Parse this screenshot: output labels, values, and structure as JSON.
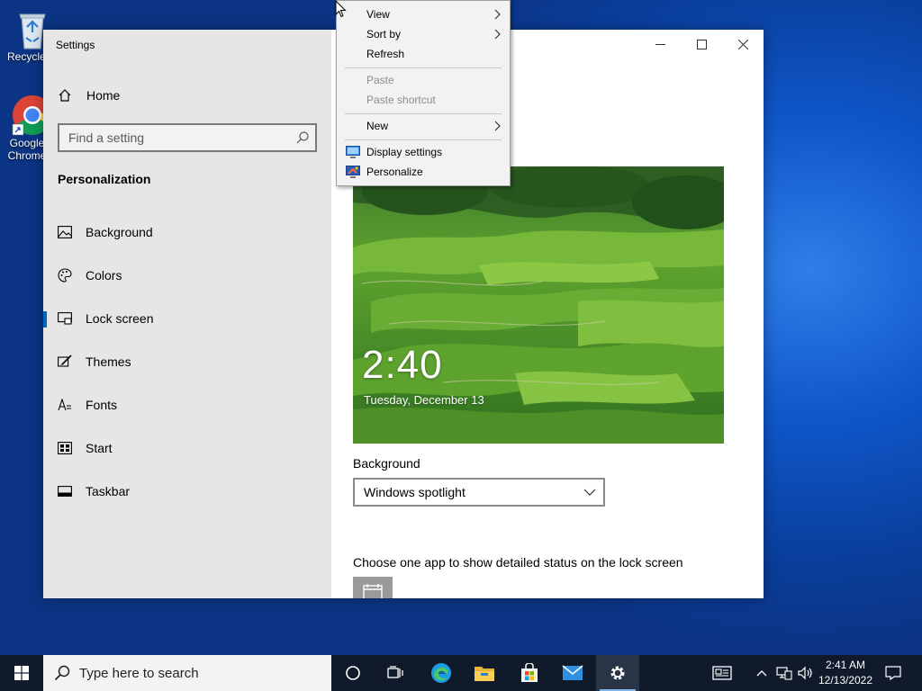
{
  "desktop": {
    "icons": [
      {
        "label": "Recycle Bin"
      },
      {
        "label": "Google Chrome"
      }
    ]
  },
  "settings": {
    "window_title": "Settings",
    "home_label": "Home",
    "search_placeholder": "Find a setting",
    "section_title": "Personalization",
    "nav_items": [
      {
        "label": "Background",
        "icon": "picture-icon"
      },
      {
        "label": "Colors",
        "icon": "palette-icon"
      },
      {
        "label": "Lock screen",
        "icon": "lock-screen-icon",
        "active": true
      },
      {
        "label": "Themes",
        "icon": "brush-icon"
      },
      {
        "label": "Fonts",
        "icon": "fonts-icon"
      },
      {
        "label": "Start",
        "icon": "start-icon"
      },
      {
        "label": "Taskbar",
        "icon": "taskbar-icon"
      }
    ],
    "preview": {
      "time": "2:40",
      "date": "Tuesday, December 13"
    },
    "background_label": "Background",
    "background_value": "Windows spotlight",
    "status_label": "Choose one app to show detailed status on the lock screen"
  },
  "context_menu": {
    "items": [
      {
        "label": "View",
        "submenu": true,
        "enabled": true
      },
      {
        "label": "Sort by",
        "submenu": true,
        "enabled": true
      },
      {
        "label": "Refresh",
        "submenu": false,
        "enabled": true
      },
      {
        "label": "Paste",
        "submenu": false,
        "enabled": false
      },
      {
        "label": "Paste shortcut",
        "submenu": false,
        "enabled": false
      },
      {
        "label": "New",
        "submenu": true,
        "enabled": true
      },
      {
        "label": "Display settings",
        "submenu": false,
        "enabled": true,
        "icon": "display-icon"
      },
      {
        "label": "Personalize",
        "submenu": false,
        "enabled": true,
        "icon": "personalize-icon"
      }
    ]
  },
  "taskbar": {
    "search_placeholder": "Type here to search",
    "clock_time": "2:41 AM",
    "clock_date": "12/13/2022",
    "apps": [
      "cortana-icon",
      "task-view-icon",
      "edge-icon",
      "file-explorer-icon",
      "store-icon",
      "mail-icon",
      "settings-icon"
    ],
    "active_app": "settings-icon"
  },
  "colors": {
    "accent": "#0067c0",
    "sidebar_bg": "#e6e6e6",
    "taskbar_bg": "#101a2b",
    "menu_bg": "#f2f2f2"
  }
}
